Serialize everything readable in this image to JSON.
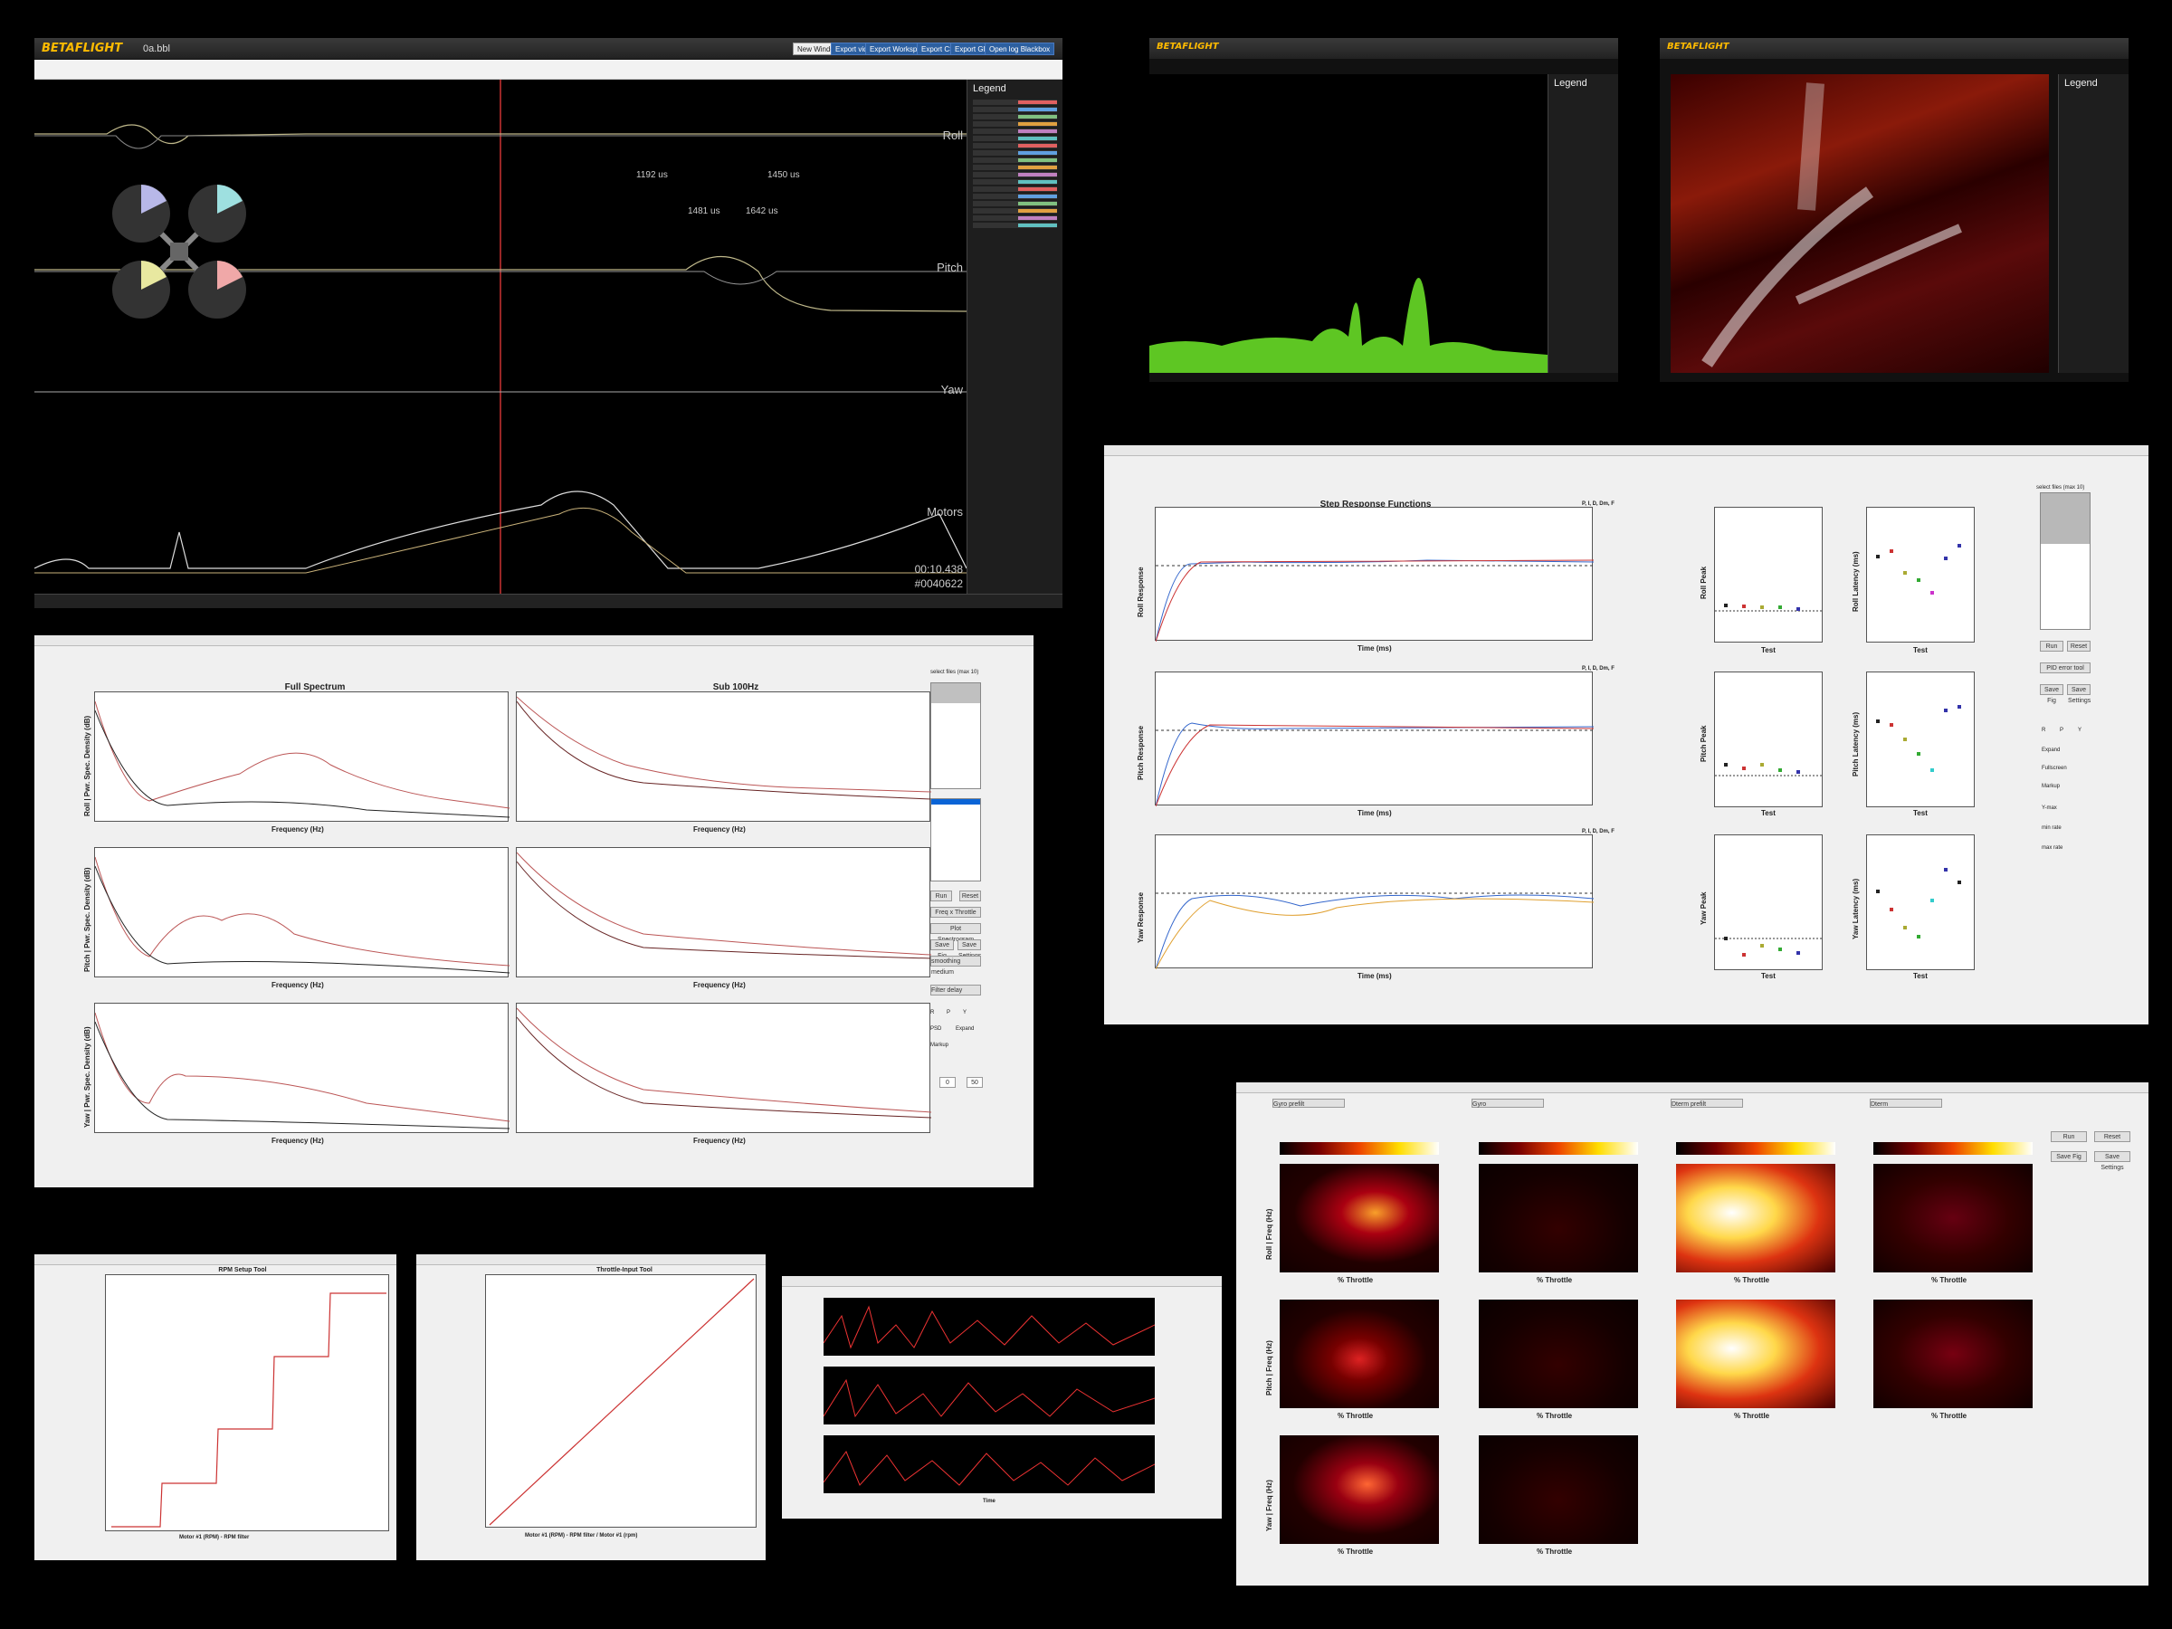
{
  "bf_main": {
    "logo": "BETAFLIGHT",
    "filename": "0a.bbl",
    "buttons": [
      "New Window",
      "Export video",
      "Export Workspace",
      "Export CSV",
      "Export GPX",
      "Open log Blackbox"
    ],
    "axes": [
      "Roll",
      "Pitch",
      "Yaw",
      "Motors"
    ],
    "motor_values": [
      "1192 us",
      "1450 us",
      "1481 us",
      "1642 us"
    ],
    "legend_title": "Legend",
    "legend_groups": [
      "Roll",
      "Pitch",
      "Yaw",
      "Motors"
    ],
    "time": "00:10.438",
    "frame": "#0040622"
  },
  "bf_spectrum": {
    "logo": "BETAFLIGHT",
    "legend_title": "Legend"
  },
  "bf_heatmap": {
    "logo": "BETAFLIGHT",
    "legend_title": "Legend"
  },
  "spectrum_win": {
    "title_left": "Full Spectrum",
    "title_right": "Sub 100Hz",
    "xlabel": "Frequency (Hz)",
    "ylabels": [
      "Roll | Pwr. Spec. Density (dB)",
      "Pitch | Pwr. Spec. Density (dB)",
      "Yaw | Pwr. Spec. Density (dB)"
    ],
    "files_label": "select files (max 10)",
    "buttons": [
      "Run",
      "Reset",
      "Freq x Throttle",
      "Plot Spectrogram",
      "Save Fig",
      "Save Settings"
    ],
    "dropdowns": [
      "smoothing medium",
      "Filter delay"
    ],
    "radios": [
      "R",
      "P",
      "Y",
      "PSD",
      "Expand",
      "Markup"
    ],
    "fields": [
      "0",
      "50"
    ]
  },
  "step_win": {
    "title": "Step Response Functions",
    "xlabel": "Time (ms)",
    "ylabels": [
      "Roll Response",
      "Pitch Response",
      "Yaw Response"
    ],
    "peak_labels": [
      "Roll Peak",
      "Pitch Peak",
      "Yaw Peak"
    ],
    "latency_labels": [
      "Roll Latency (ms)",
      "Pitch Latency (ms)",
      "Yaw Latency (ms)"
    ],
    "test_label": "Test",
    "files_label": "select files (max 10)",
    "pid_header": "P, I, D, Dm, F",
    "buttons": [
      "Run",
      "Reset",
      "PID error tool",
      "Save Fig",
      "Save Settings"
    ],
    "radios": [
      "R",
      "P",
      "Y",
      "Expand",
      "Fullscreen",
      "Markup"
    ],
    "fields": [
      "Y-max",
      "min rate",
      "max rate"
    ]
  },
  "heat_win": {
    "xlabel": "% Throttle",
    "ylabels": [
      "Roll | Freq (Hz)",
      "Pitch | Freq (Hz)",
      "Yaw | Freq (Hz)"
    ],
    "dropdowns": [
      "Gyro prefilt",
      "Gyro",
      "Dterm prefilt",
      "Dterm"
    ],
    "buttons": [
      "Run",
      "Reset",
      "Save Fig",
      "Save Settings"
    ]
  },
  "rate_win": {
    "title": "RPM Setup Tool",
    "xlabel": "Motor #1 (RPM) - RPM filter"
  },
  "throttle_win": {
    "title": "Throttle-Input Tool",
    "xlabel": "Motor #1 (RPM) - RPM filter / Motor #1 (rpm)"
  },
  "gyro_win": {
    "xlabel": "Time"
  }
}
